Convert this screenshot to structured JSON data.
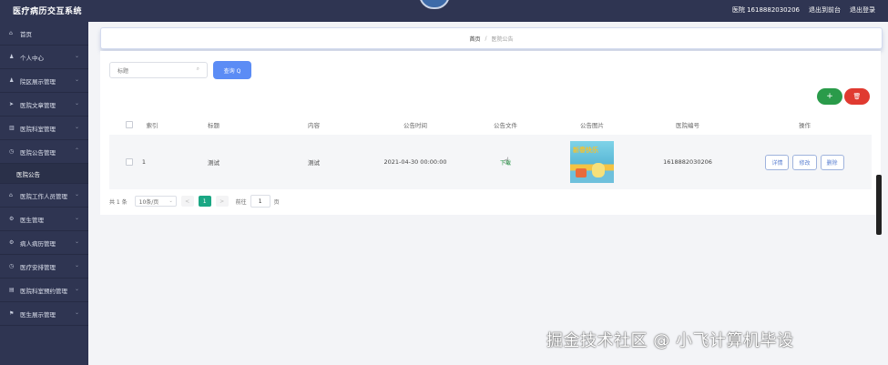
{
  "app": {
    "title": "医疗病历交互系统"
  },
  "header": {
    "user_label": "医院 1618882030206",
    "back_label": "退出到前台",
    "logout_label": "退出登录"
  },
  "sidebar": {
    "items": [
      {
        "label": "首页",
        "icon": "home-icon",
        "glyph": "⌂"
      },
      {
        "label": "个人中心",
        "icon": "user-icon",
        "glyph": "♟"
      },
      {
        "label": "院区展示管理",
        "icon": "user-icon",
        "glyph": "♟"
      },
      {
        "label": "医院文章管理",
        "icon": "send-icon",
        "glyph": "➤"
      },
      {
        "label": "医院科室管理",
        "icon": "bar-chart-icon",
        "glyph": "▥"
      },
      {
        "label": "医院公告管理",
        "icon": "clock-icon",
        "glyph": "◷"
      },
      {
        "label": "医院工作人员管理",
        "icon": "bank-icon",
        "glyph": "⌂"
      },
      {
        "label": "医生管理",
        "icon": "gear-icon",
        "glyph": "⚙"
      },
      {
        "label": "病人病历管理",
        "icon": "gear-icon",
        "glyph": "⚙"
      },
      {
        "label": "医疗安排管理",
        "icon": "clock-icon",
        "glyph": "◷"
      },
      {
        "label": "医院科室预约管理",
        "icon": "list-icon",
        "glyph": "▤"
      },
      {
        "label": "医生展示管理",
        "icon": "flag-icon",
        "glyph": "⚑"
      }
    ],
    "sub_item": "医院公告"
  },
  "breadcrumb": {
    "home": "首页",
    "current": "医院公告"
  },
  "search": {
    "placeholder": "标题",
    "button": "查询 Q"
  },
  "actions": {
    "add": "+",
    "delete": "🗑"
  },
  "table": {
    "headers": [
      "索引",
      "标题",
      "内容",
      "公告时间",
      "公告文件",
      "公告图片",
      "医院编号",
      "操作"
    ],
    "rows": [
      {
        "index": "1",
        "title": "测试",
        "content": "测试",
        "time": "2021-04-30 00:00:00",
        "file": "下载",
        "image_text": "新春快乐",
        "hospital_no": "1618882030206"
      }
    ],
    "row_buttons": [
      "详情",
      "修改",
      "删除"
    ]
  },
  "pagination": {
    "total": "共 1 条",
    "page_size": "10条/页",
    "prev": "<",
    "current": "1",
    "next": ">",
    "goto_prefix": "前往",
    "goto_value": "1",
    "goto_suffix": "页"
  },
  "watermark": "掘金技术社区 @ 小飞计算机毕设"
}
